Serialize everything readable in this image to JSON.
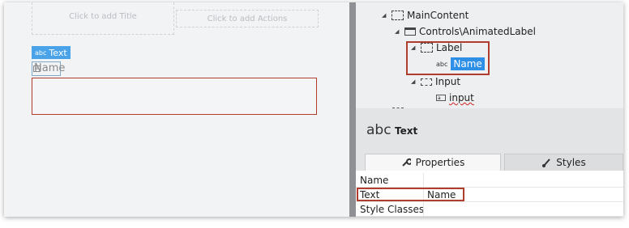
{
  "canvas": {
    "title_placeholder": "Click to add Title",
    "actions_placeholder": "Click to add Actions",
    "text_chip": {
      "icon": "abc",
      "label": "Text"
    },
    "name_label": "Name"
  },
  "tree": {
    "items": [
      {
        "label": "MainContent",
        "icon": "container-icon"
      },
      {
        "label": "Controls\\AnimatedLabel",
        "icon": "widget-icon"
      },
      {
        "label": "Label",
        "icon": "container-icon"
      },
      {
        "label": "Name",
        "icon_text": "abc",
        "selected": true
      },
      {
        "label": "Input",
        "icon": "container-icon"
      },
      {
        "label": "input",
        "icon_text": "a"
      }
    ]
  },
  "properties": {
    "header_icon": "abc",
    "header_title": "Text",
    "tabs": [
      {
        "label": "Properties",
        "icon": "wrench-icon",
        "active": true
      },
      {
        "label": "Styles",
        "icon": "brush-icon",
        "active": false
      }
    ],
    "rows": [
      {
        "key": "Name",
        "value": ""
      },
      {
        "key": "Text",
        "value": "Name"
      },
      {
        "key": "Style Classes",
        "value": ""
      }
    ]
  },
  "colors": {
    "highlight_red": "#b03d2c",
    "selection_blue": "#2e8fe6",
    "chip_blue": "#4aa3e8"
  }
}
